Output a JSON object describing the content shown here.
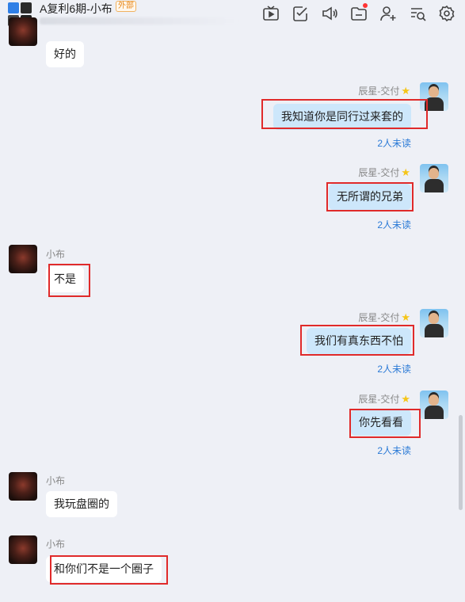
{
  "header": {
    "title": "A复利6期-小布",
    "badge": "外部",
    "icons": [
      "video-icon",
      "checklist-icon",
      "announcement-icon",
      "folder-icon",
      "add-member-icon",
      "search-history-icon",
      "settings-icon"
    ]
  },
  "messages": [
    {
      "side": "left",
      "sender": "",
      "text": "好的"
    },
    {
      "side": "right",
      "sender": "辰星-交付",
      "text": "我知道你是同行过来套的",
      "status": "2人未读"
    },
    {
      "side": "right",
      "sender": "辰星-交付",
      "text": "无所谓的兄弟",
      "status": "2人未读"
    },
    {
      "side": "left",
      "sender": "小布",
      "text": "不是"
    },
    {
      "side": "right",
      "sender": "辰星-交付",
      "text": "我们有真东西不怕",
      "status": "2人未读"
    },
    {
      "side": "right",
      "sender": "辰星-交付",
      "text": "你先看看",
      "status": "2人未读"
    },
    {
      "side": "left",
      "sender": "小布",
      "text": "我玩盘圈的"
    },
    {
      "side": "left",
      "sender": "小布",
      "text": "和你们不是一个圈子"
    }
  ],
  "colors": {
    "highlight": "#e02a2a",
    "bubble_out": "#cde7fb",
    "bubble_in": "#ffffff",
    "link": "#2b7ad6"
  }
}
